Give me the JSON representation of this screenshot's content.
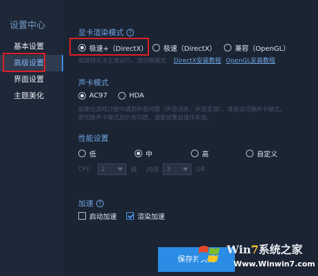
{
  "sidebar": {
    "title": "设置中心",
    "items": [
      {
        "label": "基本设置"
      },
      {
        "label": "高级设置"
      },
      {
        "label": "界面设置"
      },
      {
        "label": "主题美化"
      }
    ]
  },
  "display": {
    "title": "显卡渲染模式",
    "options": [
      "极速+（DirectX）",
      "极速（DirectX）",
      "兼容（OpenGL）"
    ],
    "selected": "极速+（DirectX）",
    "hint": "如游戏无法正常运行，请切换模式.",
    "link1": "DirectX安装教程",
    "link2": "OpenGL安装教程"
  },
  "audio": {
    "title": "声卡模式",
    "options": [
      "AC97",
      "HDA"
    ],
    "selected": "AC97",
    "hint1": "如果在游戏过程中遇到声音问题（声音消失、声音变调），请尝试切换声卡模式。",
    "hint2": "若切换声卡模式后仍有问题，请尝试重自操作系统。"
  },
  "performance": {
    "title": "性能设置",
    "options": [
      "低",
      "中",
      "高",
      "自定义"
    ],
    "selected": "中",
    "cpu_label": "CPU",
    "cpu_value": "2",
    "cpu_unit": "核",
    "mem_label": "内存",
    "mem_value": "3",
    "mem_unit": "GB"
  },
  "accel": {
    "title": "加速",
    "options": [
      {
        "label": "启动加速",
        "checked": false
      },
      {
        "label": "渲染加速",
        "checked": true
      }
    ]
  },
  "save_button": "保存并关闭",
  "watermark": {
    "brand_pre": "Win",
    "brand_seven": "7",
    "brand_post": "系统之家",
    "url": "Www.Winwin7.com"
  },
  "colors": {
    "accent": "#2b8ce5",
    "highlight_box": "#e01e25",
    "background": "#1b2433"
  }
}
